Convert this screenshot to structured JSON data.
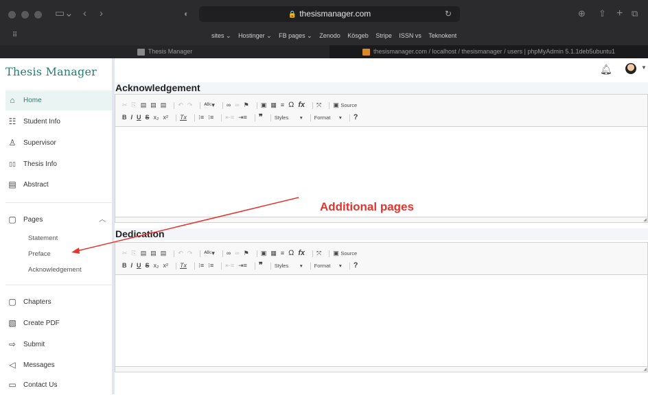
{
  "browser": {
    "url": "thesismanager.com",
    "favorites": [
      "sites ⌄",
      "Hostinger ⌄",
      "FB pages ⌄",
      "Zenodo",
      "Kösgeb",
      "Stripe",
      "ISSN vs",
      "Teknokent"
    ],
    "tabs": [
      {
        "label": "Thesis Manager"
      },
      {
        "label": "thesismanager.com / localhost / thesismanager / users | phpMyAdmin 5.1.1deb5ubuntu1"
      }
    ]
  },
  "app": {
    "brand": "Thesis Manager"
  },
  "sidebar": {
    "items": [
      {
        "label": "Home",
        "icon": "home-icon",
        "glyph": "⌂"
      },
      {
        "label": "Student Info",
        "icon": "student-icon",
        "glyph": "☷"
      },
      {
        "label": "Supervisor",
        "icon": "supervisor-icon",
        "glyph": "♙"
      },
      {
        "label": "Thesis Info",
        "icon": "book-icon",
        "glyph": "▯▯"
      },
      {
        "label": "Abstract",
        "icon": "document-icon",
        "glyph": "▤"
      },
      {
        "label": "Pages",
        "icon": "pages-icon",
        "glyph": "▢"
      },
      {
        "label": "Chapters",
        "icon": "chapters-icon",
        "glyph": "▢"
      },
      {
        "label": "Create PDF",
        "icon": "pdf-icon",
        "glyph": "▧"
      },
      {
        "label": "Submit",
        "icon": "arrow-right-icon",
        "glyph": "⇨"
      },
      {
        "label": "Messages",
        "icon": "send-icon",
        "glyph": "◁"
      },
      {
        "label": "Contact Us",
        "icon": "contact-icon",
        "glyph": "▭"
      }
    ],
    "pages_submenu": [
      "Statement",
      "Preface",
      "Acknowledgement"
    ]
  },
  "main": {
    "sections": [
      {
        "title": "Acknowledgement"
      },
      {
        "title": "Dedication"
      }
    ],
    "editor": {
      "combo_styles": "Styles",
      "combo_format": "Format",
      "source_label": "Source",
      "help": "?"
    }
  },
  "annotation": {
    "text": "Additional pages",
    "color": "#e8322c"
  },
  "colors": {
    "brand": "#1f7e73",
    "active_bg": "#eaf5f3"
  }
}
